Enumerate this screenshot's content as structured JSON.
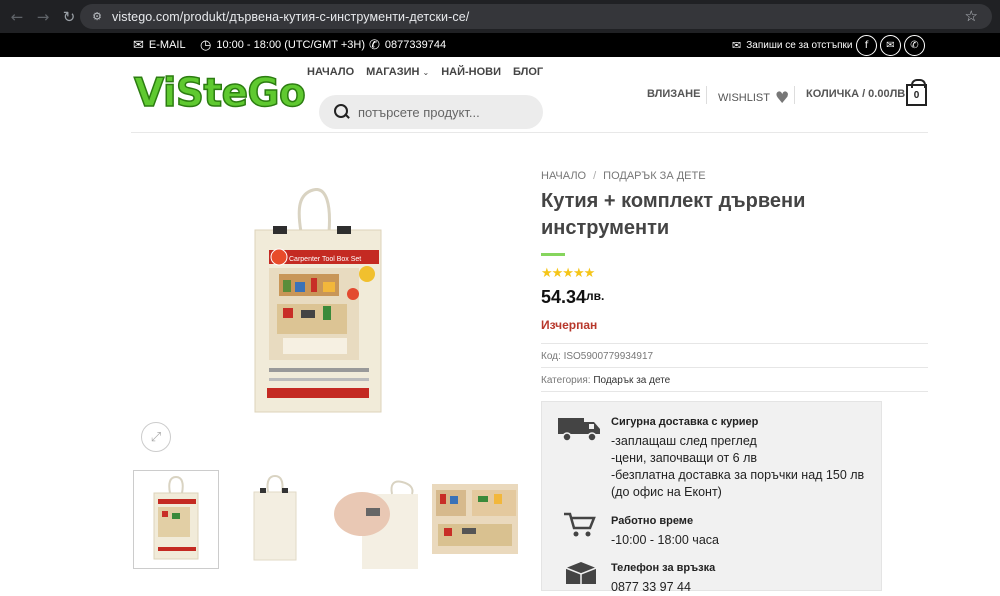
{
  "browser": {
    "url": "vistego.com/produkt/дървена-кутия-с-инструменти-детски-се/"
  },
  "topbar": {
    "email_label": "E-MAIL",
    "hours": "10:00 - 18:00 (UTC/GMT +3H)",
    "phone": "0877339744",
    "subscribe": "Запиши се за отстъпки"
  },
  "header": {
    "logo": "ViSteGo",
    "nav": [
      "НАЧАЛО",
      "МАГАЗИН",
      "НАЙ-НОВИ",
      "БЛОГ"
    ],
    "search_placeholder": "потърсете продукт...",
    "login": "ВЛИЗАНЕ",
    "wishlist": "WISHLIST",
    "cart_label": "КОЛИЧКА / 0.00ЛВ.",
    "cart_count": "0"
  },
  "product": {
    "breadcrumb": [
      "НАЧАЛО",
      "ПОДАРЪК ЗА ДЕТЕ"
    ],
    "breadcrumb_sep": "/",
    "title": "Кутия + комплект дървени инструменти",
    "rating": 5,
    "rating_stars": "★★★★★",
    "price": "54.34",
    "currency": "лв.",
    "stock": "Изчерпан",
    "sku_label": "Код:",
    "sku": "ISO5900779934917",
    "category_label": "Категория:",
    "category": "Подарък за дете",
    "box_label": "Carpenter Tool Box Set"
  },
  "info_box": {
    "delivery_title": "Сигурна доставка с куриер",
    "delivery_lines": [
      "-заплащаш след преглед",
      "-цени, започващи от 6 лв",
      "-безплатна доставка за поръчки над 150 лв",
      "(до офис на Еконт)"
    ],
    "hours_title": "Работно време",
    "hours_text": "-10:00 - 18:00 часа",
    "phone_title": "Телефон за връзка",
    "phone_text": "0877 33 97 44"
  },
  "colors": {
    "accent_green": "#86d55d",
    "logo_green": "#5fc930",
    "out_of_stock": "#b7372b",
    "star": "#f5c518"
  }
}
